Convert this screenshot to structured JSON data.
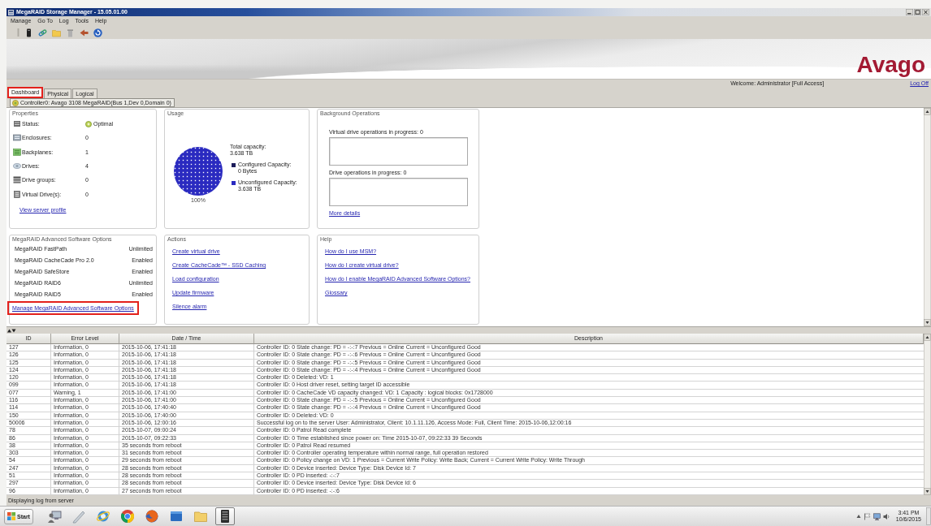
{
  "window": {
    "title": "MegaRAID Storage Manager - 15.05.01.00"
  },
  "menu": [
    "Manage",
    "Go To",
    "Log",
    "Tools",
    "Help"
  ],
  "header": {
    "logo": "Avago",
    "welcome": "Welcome: Administrator [Full Access]",
    "log_off": "Log Off"
  },
  "tabs": [
    {
      "label": "Dashboard",
      "selected": true,
      "highlighted": true
    },
    {
      "label": "Physical",
      "selected": false,
      "highlighted": false
    },
    {
      "label": "Logical",
      "selected": false,
      "highlighted": false
    }
  ],
  "controller": {
    "label": "Controller0: Avago 3108 MegaRAID(Bus 1,Dev 0,Domain 0)"
  },
  "properties": {
    "title": "Properties",
    "items": [
      {
        "kind": "status",
        "label": "Status:",
        "value": "Optimal"
      },
      {
        "kind": "enclosures",
        "label": "Enclosures:",
        "value": "0"
      },
      {
        "kind": "backplanes",
        "label": "Backplanes:",
        "value": "1"
      },
      {
        "kind": "drives",
        "label": "Drives:",
        "value": "4"
      },
      {
        "kind": "drive_groups",
        "label": "Drive groups:",
        "value": "0"
      },
      {
        "kind": "virtual_drives",
        "label": "Virtual Drive(s):",
        "value": "0"
      }
    ],
    "link": "View server profile"
  },
  "usage": {
    "title": "Usage",
    "total_label": "Total capacity:",
    "total_value": "3.638 TB",
    "chart_data": {
      "type": "pie",
      "categories": [
        "Configured Capacity:\n0 Bytes",
        "Unconfigured Capacity:\n3.638 TB"
      ],
      "values": [
        0,
        100
      ],
      "colors": [
        "#1c1c5a",
        "#2a2ac0"
      ],
      "value_labels": [
        null,
        "100%"
      ]
    }
  },
  "background_operations": {
    "title": "Background Operations",
    "lists": [
      {
        "label": "Virtual drive operations in progress: 0"
      },
      {
        "label": "Drive operations in progress: 0"
      }
    ],
    "link": "More details"
  },
  "software_options": {
    "title": "MegaRAID Advanced Software Options",
    "items": [
      {
        "name": "MegaRAID FastPath",
        "status": "Unlimited"
      },
      {
        "name": "MegaRAID CacheCade Pro 2.0",
        "status": "Enabled"
      },
      {
        "name": "MegaRAID SafeStore",
        "status": "Enabled"
      },
      {
        "name": "MegaRAID RAID6",
        "status": "Unlimited"
      },
      {
        "name": "MegaRAID RAID5",
        "status": "Enabled"
      }
    ],
    "link": {
      "label": "Manage MegaRAID Advanced Software Options",
      "highlighted": true
    }
  },
  "actions": {
    "title": "Actions",
    "links": [
      "Create virtual drive",
      "Create CacheCade™ - SSD Caching",
      "Load configuration",
      "Update firmware",
      "Silence alarm"
    ]
  },
  "help": {
    "title": "Help",
    "links": [
      "How do I use MSM?",
      "How do I create virtual drive?",
      "How do I enable MegaRAID Advanced Software Options?",
      "Glossary"
    ]
  },
  "log": {
    "columns": [
      "ID",
      "Error Level",
      "Date / Time",
      "Description"
    ],
    "rows": [
      [
        "127",
        "Information, 0",
        "2015-10-06, 17:41:18",
        "Controller ID: 0 State change: PD = -:-:7 Previous = Online Current = Unconfigured Good"
      ],
      [
        "126",
        "Information, 0",
        "2015-10-06, 17:41:18",
        "Controller ID: 0 State change: PD = -:-:6 Previous = Online Current = Unconfigured Good"
      ],
      [
        "125",
        "Information, 0",
        "2015-10-06, 17:41:18",
        "Controller ID: 0 State change: PD = -:-:5 Previous = Online Current = Unconfigured Good"
      ],
      [
        "124",
        "Information, 0",
        "2015-10-06, 17:41:18",
        "Controller ID: 0 State change: PD = -:-:4 Previous = Online Current = Unconfigured Good"
      ],
      [
        "120",
        "Information, 0",
        "2015-10-06, 17:41:18",
        "Controller ID: 0 Deleted: VD: 1"
      ],
      [
        "099",
        "Information, 0",
        "2015-10-06, 17:41:18",
        "Controller ID: 0 Host driver reset, setting target ID accessible"
      ],
      [
        "077",
        "Warning, 1",
        "2015-10-06, 17:41:00",
        "Controller ID: 0 CacheCade VD capacity changed: VD: 1 Capacity : logical blocks: 0x1728000"
      ],
      [
        "116",
        "Information, 0",
        "2015-10-06, 17:41:00",
        "Controller ID: 0 State change: PD = -:-:5 Previous = Online Current = Unconfigured Good"
      ],
      [
        "114",
        "Information, 0",
        "2015-10-06, 17:40:40",
        "Controller ID: 0 State change: PD = -:-:4 Previous = Online Current = Unconfigured Good"
      ],
      [
        "150",
        "Information, 0",
        "2015-10-06, 17:40:00",
        "Controller ID: 0 Deleted: VD: 0"
      ],
      [
        "50006",
        "Information, 0",
        "2015-10-06, 12:00:16",
        "Successful log on to the server User: Administrator, Client: 10.1.11.126, Access Mode: Full, Client Time: 2015-10-06,12:00:16"
      ],
      [
        "78",
        "Information, 0",
        "2015-10-07, 09:00:24",
        "Controller ID: 0 Patrol Read complete"
      ],
      [
        "86",
        "Information, 0",
        "2015-10-07, 09:22:33",
        "Controller ID: 0 Time established since power on: Time 2015-10-07, 09:22:33 39 Seconds"
      ],
      [
        "38",
        "Information, 0",
        "35 seconds from reboot",
        "Controller ID: 0 Patrol Read resumed"
      ],
      [
        "303",
        "Information, 0",
        "31 seconds from reboot",
        "Controller ID: 0 Controller operating temperature within normal range, full operation restored"
      ],
      [
        "54",
        "Information, 0",
        "29 seconds from reboot",
        "Controller ID: 0 Policy change on VD: 1 Previous = Current Write Policy: Write Back; Current = Current Write Policy: Write Through"
      ],
      [
        "247",
        "Information, 0",
        "28 seconds from reboot",
        "Controller ID: 0 Device inserted: Device Type: Disk Device Id: 7"
      ],
      [
        "51",
        "Information, 0",
        "28 seconds from reboot",
        "Controller ID: 0 PD inserted: -:-:7"
      ],
      [
        "297",
        "Information, 0",
        "28 seconds from reboot",
        "Controller ID: 0 Device inserted: Device Type: Disk Device Id: 6"
      ],
      [
        "96",
        "Information, 0",
        "27 seconds from reboot",
        "Controller ID: 0 PD inserted: -:-:6"
      ]
    ]
  },
  "status_bar": "Displaying log from server",
  "taskbar": {
    "start": "Start",
    "apps": [
      {
        "kind": "user-computer",
        "active": false
      },
      {
        "kind": "pen",
        "active": false
      },
      {
        "kind": "ring-globe",
        "active": false
      },
      {
        "kind": "segmented-circle",
        "active": false
      },
      {
        "kind": "globe",
        "active": false
      },
      {
        "kind": "window",
        "active": false
      },
      {
        "kind": "folder",
        "active": false
      },
      {
        "kind": "server",
        "active": true
      }
    ],
    "clock": {
      "time": "3:41 PM",
      "date": "10/6/2015"
    }
  }
}
